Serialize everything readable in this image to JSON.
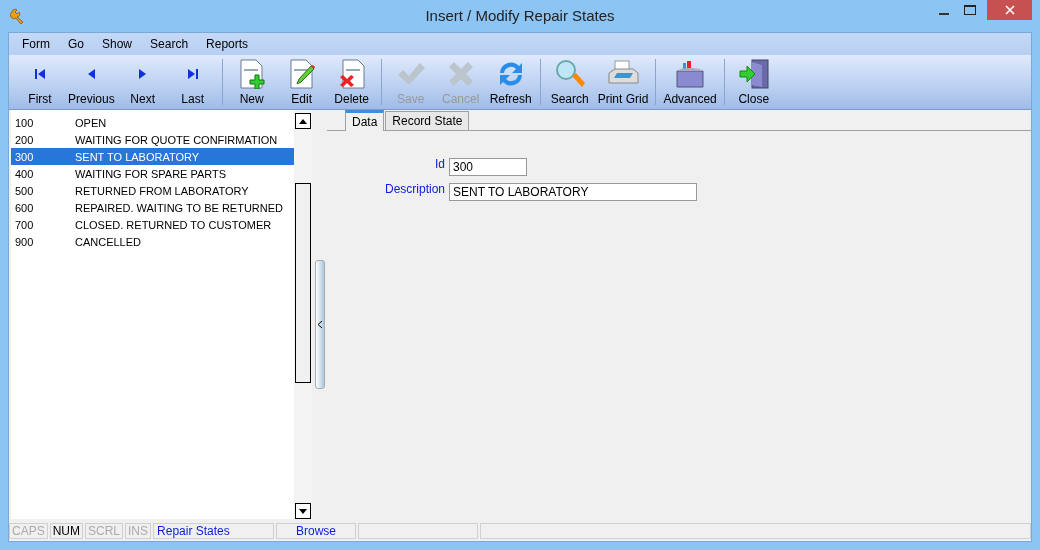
{
  "window": {
    "title": "Insert / Modify Repair States"
  },
  "menu": [
    "Form",
    "Go",
    "Show",
    "Search",
    "Reports"
  ],
  "toolbar": {
    "groups": [
      [
        {
          "label": "First",
          "disabled": false
        },
        {
          "label": "Previous",
          "disabled": false
        },
        {
          "label": "Next",
          "disabled": false
        },
        {
          "label": "Last",
          "disabled": false
        }
      ],
      [
        {
          "label": "New",
          "disabled": false
        },
        {
          "label": "Edit",
          "disabled": false
        },
        {
          "label": "Delete",
          "disabled": false
        }
      ],
      [
        {
          "label": "Save",
          "disabled": true
        },
        {
          "label": "Cancel",
          "disabled": true
        },
        {
          "label": "Refresh",
          "disabled": false
        }
      ],
      [
        {
          "label": "Search",
          "disabled": false
        },
        {
          "label": "Print Grid",
          "disabled": false
        }
      ],
      [
        {
          "label": "Advanced",
          "disabled": false
        }
      ],
      [
        {
          "label": "Close",
          "disabled": false
        }
      ]
    ]
  },
  "list": {
    "rows": [
      {
        "id": "100",
        "description": "OPEN",
        "selected": false
      },
      {
        "id": "200",
        "description": "WAITING FOR QUOTE CONFIRMATION",
        "selected": false
      },
      {
        "id": "300",
        "description": "SENT TO LABORATORY",
        "selected": true
      },
      {
        "id": "400",
        "description": "WAITING FOR SPARE PARTS",
        "selected": false
      },
      {
        "id": "500",
        "description": "RETURNED FROM LABORATORY",
        "selected": false
      },
      {
        "id": "600",
        "description": "REPAIRED. WAITING TO BE RETURNED",
        "selected": false
      },
      {
        "id": "700",
        "description": "CLOSED. RETURNED TO CUSTOMER",
        "selected": false
      },
      {
        "id": "900",
        "description": "CANCELLED",
        "selected": false
      }
    ]
  },
  "tabs": [
    {
      "label": "Data",
      "selected": true
    },
    {
      "label": "Record State",
      "selected": false
    }
  ],
  "form": {
    "fields": [
      {
        "label": "Id",
        "value": "300",
        "kind": "short"
      },
      {
        "label": "Description",
        "value": "SENT TO LABORATORY",
        "kind": "long"
      }
    ]
  },
  "status_bar": {
    "keys": [
      {
        "label": "CAPS",
        "on": false
      },
      {
        "label": "NUM",
        "on": true
      },
      {
        "label": "SCRL",
        "on": false
      },
      {
        "label": "INS",
        "on": false
      }
    ],
    "panels": [
      "Repair States",
      "Browse"
    ]
  }
}
